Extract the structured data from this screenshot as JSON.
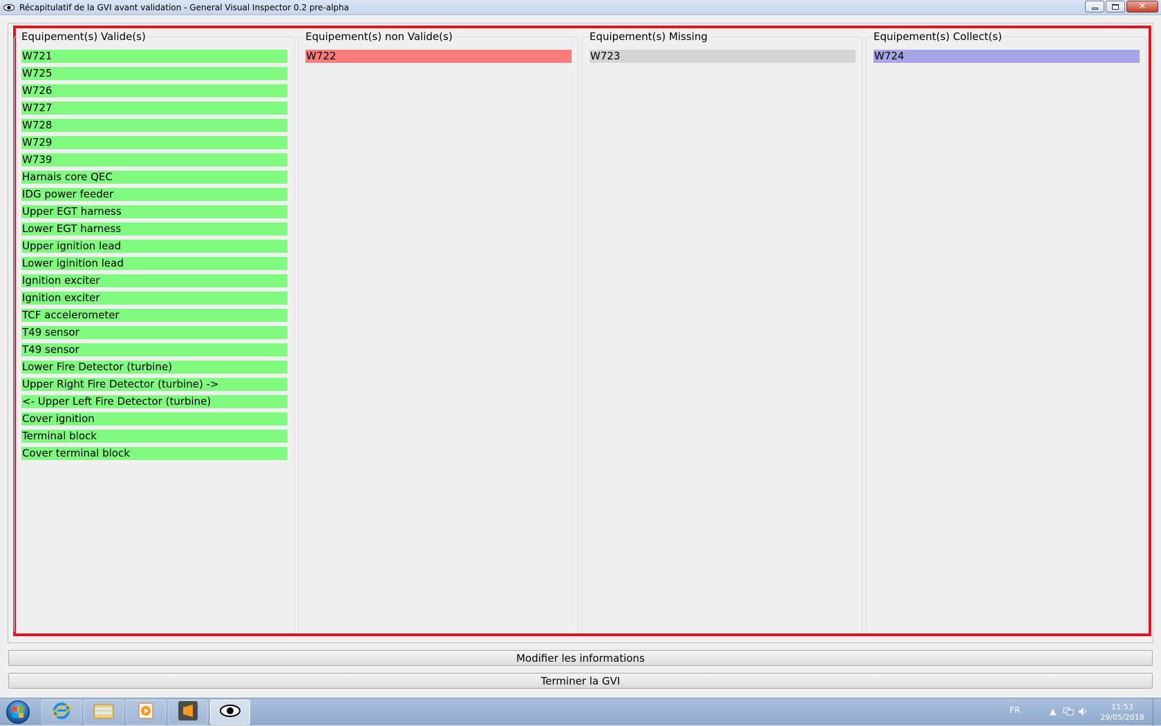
{
  "window": {
    "title": "Récapitulatif de la GVI avant validation - General Visual Inspector 0.2 pre-alpha",
    "icon": "eye-icon"
  },
  "columns": {
    "valid": {
      "header": "Equipement(s) Valide(s)",
      "color": "#80fa7e",
      "items": [
        "W721",
        "W725",
        "W726",
        "W727",
        "W728",
        "W729",
        "W739",
        "Harnais core QEC",
        "IDG power feeder",
        "Upper EGT harness",
        "Lower EGT harness",
        "Upper ignition lead",
        "Lower iginition lead",
        "Ignition exciter",
        "Ignition exciter",
        "TCF accelerometer",
        "T49 sensor",
        "T49 sensor",
        "Lower Fire Detector (turbine)",
        "Upper Right Fire Detector (turbine) ->",
        "<- Upper Left Fire Detector (turbine)",
        "Cover ignition",
        "Terminal block",
        "Cover terminal block"
      ]
    },
    "not_valid": {
      "header": "Equipement(s) non Valide(s)",
      "color": "#f87c7c",
      "items": [
        "W722"
      ]
    },
    "missing": {
      "header": "Equipement(s) Missing",
      "color": "#d4d4d4",
      "items": [
        "W723"
      ]
    },
    "collected": {
      "header": "Equipement(s) Collect(s)",
      "color": "#a6a6e6",
      "items": [
        "W724"
      ]
    }
  },
  "actions": {
    "modify_label": "Modifier les informations",
    "finish_label": "Terminer la GVI"
  },
  "taskbar": {
    "apps": [
      "start-orb-icon",
      "internet-explorer-icon",
      "file-explorer-icon",
      "media-player-icon",
      "sublime-text-icon",
      "eye-app-icon"
    ],
    "language": "FR",
    "time": "11:53",
    "date": "29/05/2018"
  }
}
